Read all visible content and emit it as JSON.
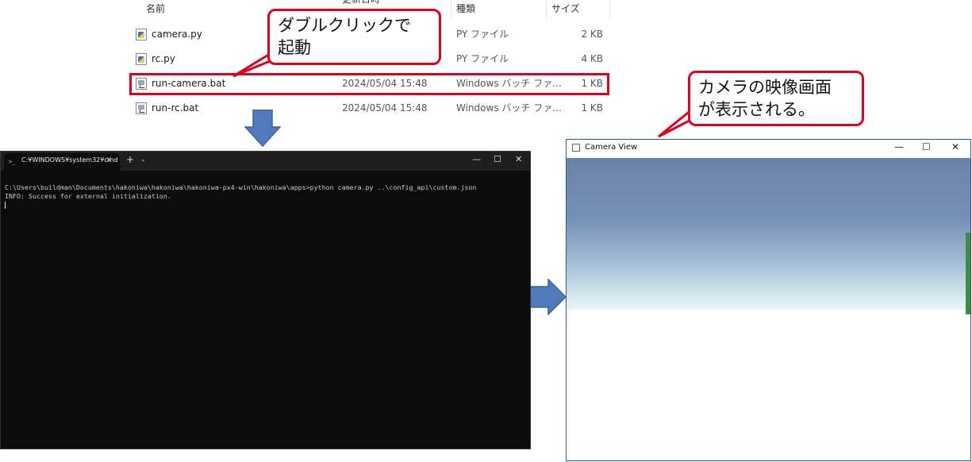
{
  "explorer": {
    "columns": {
      "name": "名前",
      "date": "更新日時",
      "type": "種類",
      "size": "サイズ"
    },
    "files": [
      {
        "name": "camera.py",
        "date": "",
        "type": "PY ファイル",
        "size": "2 KB",
        "icon": "python-file-icon"
      },
      {
        "name": "rc.py",
        "date": "",
        "type": "PY ファイル",
        "size": "4 KB",
        "icon": "python-file-icon"
      },
      {
        "name": "run-camera.bat",
        "date": "2024/05/04 15:48",
        "type": "Windows バッチ ファ...",
        "size": "1 KB",
        "icon": "batch-file-icon",
        "highlighted": true
      },
      {
        "name": "run-rc.bat",
        "date": "2024/05/04 15:48",
        "type": "Windows バッチ ファ...",
        "size": "1 KB",
        "icon": "batch-file-icon"
      }
    ]
  },
  "callouts": {
    "double_click": "ダブルクリックで\n起動",
    "camera_shown": "カメラの映像画面\nが表示される。"
  },
  "console": {
    "tab_title": "C:¥WINDOWS¥system32¥cmd",
    "tab_close": "×",
    "new_tab": "+",
    "dropdown": "⌄",
    "minimize": "—",
    "maximize": "☐",
    "close": "✕",
    "lines": [
      "C:\\Users\\buildman\\Documents\\hakoniwa\\hakoniwa\\hakoniwa-px4-win\\hakoniwa\\apps>python camera.py ..\\config_api\\custom.json",
      "INFO: Success for external initialization."
    ]
  },
  "camera_window": {
    "title": "Camera View",
    "minimize": "—",
    "maximize": "☐",
    "close": "✕"
  },
  "colors": {
    "highlight": "#e0001b",
    "arrow": "#4f7bbd",
    "console_bg": "#0c0c0c"
  }
}
